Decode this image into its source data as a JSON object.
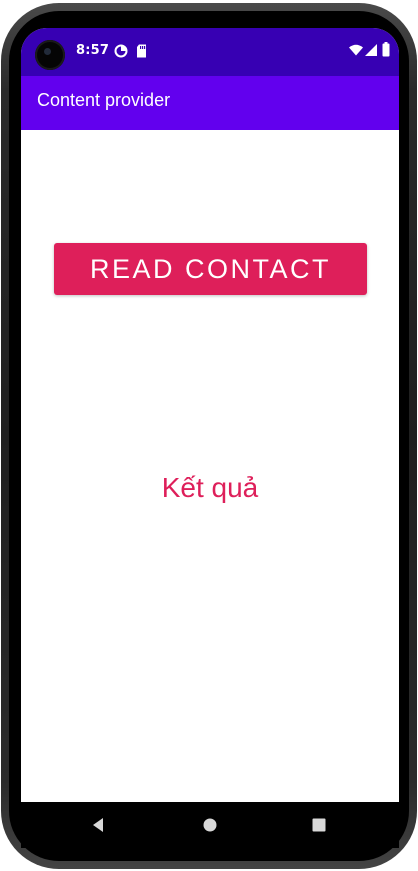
{
  "status_bar": {
    "time": "8:57",
    "left_icons": [
      "data-saver-icon",
      "sd-card-icon"
    ],
    "right_icons": [
      "wifi-icon",
      "signal-icon",
      "battery-icon"
    ],
    "background": "#3700b3"
  },
  "app_bar": {
    "title": "Content provider",
    "background": "#6200ee"
  },
  "main": {
    "read_contact_button": "READ CONTACT",
    "result_text": "Kết quả",
    "accent": "#de1f5a"
  },
  "nav_bar": {
    "buttons": [
      "back-icon",
      "home-icon",
      "recents-icon"
    ]
  }
}
